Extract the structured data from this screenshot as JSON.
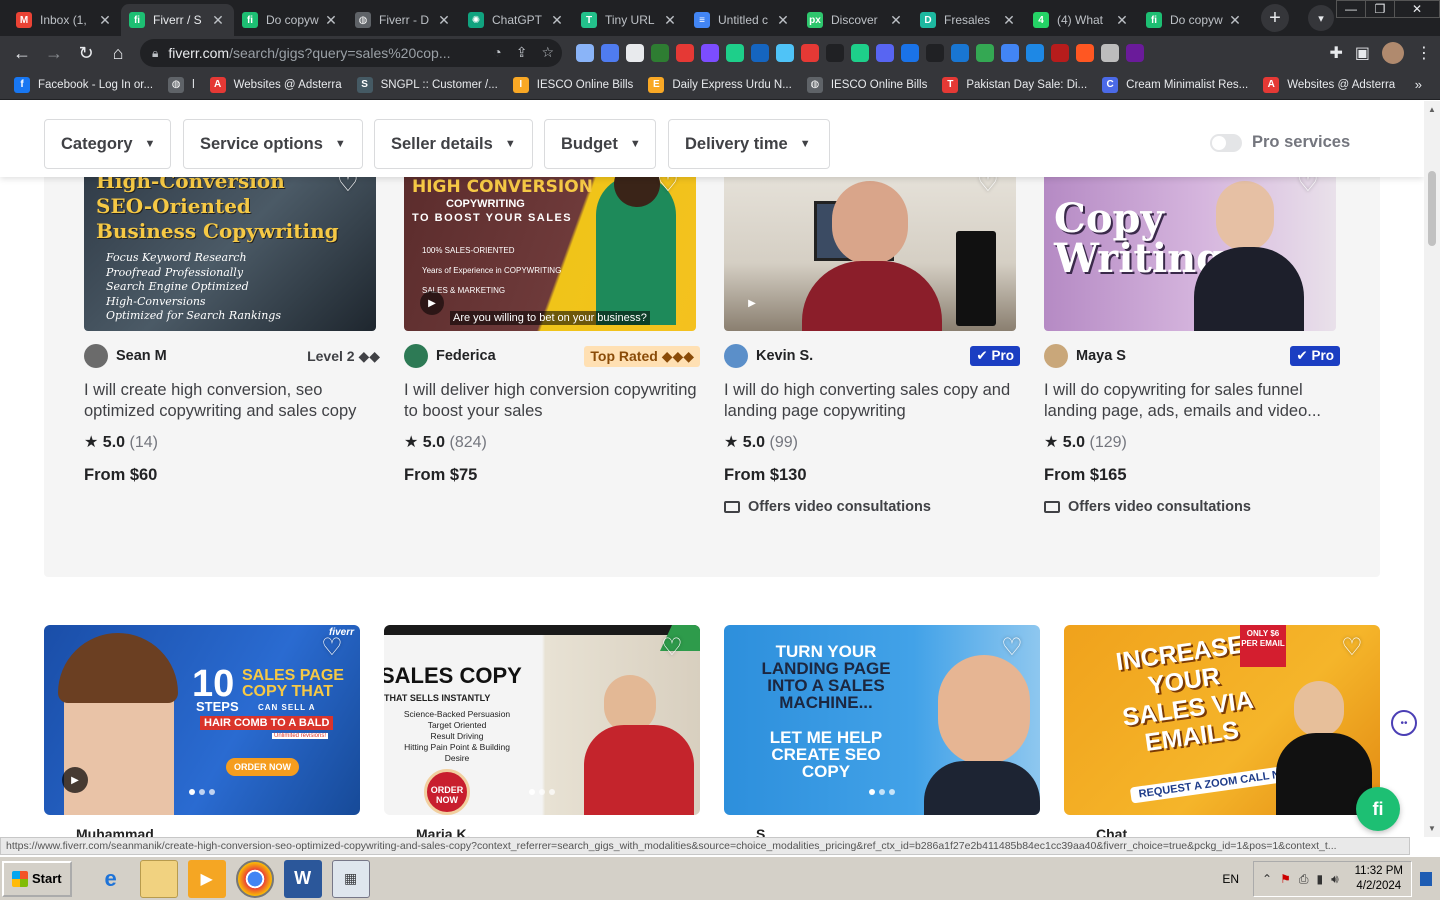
{
  "browser": {
    "tabs": [
      {
        "title": "Inbox (1,",
        "icon": "gmail-icon",
        "color": "#ea4335",
        "glyph": "M"
      },
      {
        "title": "Fiverr / S",
        "icon": "fiverr-icon",
        "color": "#1dbf73",
        "glyph": "fi",
        "active": true
      },
      {
        "title": "Do copyw",
        "icon": "fiverr-icon",
        "color": "#1dbf73",
        "glyph": "fi"
      },
      {
        "title": "Fiverr - D",
        "icon": "globe-icon",
        "color": "#5f6368",
        "glyph": "◍"
      },
      {
        "title": "ChatGPT",
        "icon": "chatgpt-icon",
        "color": "#10a37f",
        "glyph": "✺"
      },
      {
        "title": "Tiny URL",
        "icon": "tinyurl-icon",
        "color": "#23c18b",
        "glyph": "T"
      },
      {
        "title": "Untitled c",
        "icon": "docs-icon",
        "color": "#4285f4",
        "glyph": "≡"
      },
      {
        "title": "Discover",
        "icon": "pixabay-icon",
        "color": "#2ec66d",
        "glyph": "px"
      },
      {
        "title": "Fresales",
        "icon": "fresales-icon",
        "color": "#1db8a0",
        "glyph": "D"
      },
      {
        "title": "(4) What",
        "icon": "whatsapp-icon",
        "color": "#25d366",
        "glyph": "4"
      },
      {
        "title": "Do copyw",
        "icon": "fiverr-icon",
        "color": "#1dbf73",
        "glyph": "fi"
      }
    ],
    "new_tab": "+",
    "url_host": "fiverr.com",
    "url_path": "/search/gigs?query=sales%20cop...",
    "bookmarks": [
      {
        "label": "Facebook - Log In or...",
        "icon": "facebook-icon",
        "color": "#1877f2",
        "glyph": "f"
      },
      {
        "label": "l",
        "icon": "globe-icon",
        "color": "#5f6368",
        "glyph": "◍"
      },
      {
        "label": "Websites @ Adsterra",
        "icon": "adsterra-icon",
        "color": "#e53935",
        "glyph": "A"
      },
      {
        "label": "SNGPL :: Customer /...",
        "icon": "sngpl-icon",
        "color": "#455a64",
        "glyph": "S"
      },
      {
        "label": "IESCO Online Bills",
        "icon": "iesco-icon",
        "color": "#f9a825",
        "glyph": "I"
      },
      {
        "label": "Daily Express Urdu N...",
        "icon": "express-icon",
        "color": "#f9a825",
        "glyph": "E"
      },
      {
        "label": "IESCO Online Bills",
        "icon": "globe-icon",
        "color": "#5f6368",
        "glyph": "◍"
      },
      {
        "label": "Pakistan Day Sale: Di...",
        "icon": "temu-icon",
        "color": "#e53935",
        "glyph": "T"
      },
      {
        "label": "Cream Minimalist Res...",
        "icon": "canva-icon",
        "color": "#4b6ae8",
        "glyph": "C"
      },
      {
        "label": "Websites @ Adsterra",
        "icon": "adsterra-icon",
        "color": "#e53935",
        "glyph": "A"
      }
    ],
    "bookmarks_more": "»"
  },
  "filters": {
    "category": "Category",
    "service_options": "Service options",
    "seller_details": "Seller details",
    "budget": "Budget",
    "delivery_time": "Delivery time",
    "pro_services": "Pro services"
  },
  "gigs_row1": [
    {
      "seller": "Sean M",
      "badge_type": "level",
      "badge": "Level 2",
      "badge_marks": "◆◆",
      "title": "I will create high conversion, seo optimized copywriting and sales copy",
      "rating": "5.0",
      "reviews": "(14)",
      "price": "From $60",
      "video": ""
    },
    {
      "seller": "Federica",
      "badge_type": "toprated",
      "badge": "Top Rated",
      "badge_marks": "◆◆◆",
      "title": "I will deliver high conversion copywriting to boost your sales",
      "rating": "5.0",
      "reviews": "(824)",
      "price": "From $75",
      "video": ""
    },
    {
      "seller": "Kevin S.",
      "badge_type": "pro",
      "badge": "Pro",
      "badge_marks": "",
      "title": "I will do high converting sales copy and landing page copywriting",
      "rating": "5.0",
      "reviews": "(99)",
      "price": "From $130",
      "video": "Offers video consultations"
    },
    {
      "seller": "Maya S",
      "badge_type": "pro",
      "badge": "Pro",
      "badge_marks": "",
      "title": "I will do copywriting for sales funnel landing page, ads, emails and video...",
      "rating": "5.0",
      "reviews": "(129)",
      "price": "From $165",
      "video": "Offers video consultations"
    }
  ],
  "thumbs": {
    "t1_lines": [
      "High-Conversion",
      "SEO-Oriented",
      "Business Copywriting"
    ],
    "t1_sub": [
      "Focus Keyword Research",
      "Proofread Professionally",
      "Search Engine Optimized",
      "High-Conversions",
      "Optimized for Search Rankings"
    ],
    "t2_head": "HIGH CONVERSION",
    "t2_sub1": "COPYWRITING",
    "t2_sub2": "TO BOOST YOUR SALES",
    "t2_bullets": [
      "100% SALES-ORIENTED",
      "Years of Experience in COPYWRITING",
      "SALES & MARKETING"
    ],
    "t2_caption": "Are you willing to bet on your business?",
    "t4_text": "Copy Writing",
    "r2_1": {
      "big": "10",
      "a": "SALES PAGE",
      "b": "COPY THAT",
      "c": "STEPS",
      "d": "CAN SELL A",
      "e": "HAIR COMB TO A BALD",
      "f": "Unlimited revisions!",
      "cta": "ORDER NOW",
      "brand": "fiverr"
    },
    "r2_2": {
      "head": "SALES COPY",
      "sub": "THAT SELLS INSTANTLY",
      "lines": [
        "Science-Backed Persuasion",
        "Target Oriented",
        "Result Driving",
        "Hitting Pain Point & Building",
        "Desire"
      ],
      "cta": "ORDER NOW"
    },
    "r2_3": {
      "a": "TURN YOUR",
      "b": "LANDING PAGE",
      "c": "INTO A SALES",
      "d": "MACHINE...",
      "e": "LET ME HELP",
      "f": "CREATE SEO",
      "g": "COPY"
    },
    "r2_4": {
      "a": "INCREASE",
      "b": "YOUR",
      "c": "SALES VIA",
      "d": "EMAILS",
      "e": "REQUEST A ZOOM CALL NOW!",
      "tag": "ONLY $6 PER EMAIL"
    }
  },
  "row2_peek": [
    "Muhammad",
    "Maria K.",
    "S",
    "Chat"
  ],
  "fab_label": "fi",
  "status_url": "https://www.fiverr.com/seanmanik/create-high-conversion-seo-optimized-copywriting-and-sales-copy?context_referrer=search_gigs_with_modalities&source=choice_modalities_pricing&ref_ctx_id=b286a1f27e2b411485b84ec1cc39aa40&fiverr_choice=true&pckg_id=1&pos=1&context_t...",
  "taskbar": {
    "start": "Start",
    "lang": "EN",
    "time": "11:32 PM",
    "date": "4/2/2024"
  }
}
